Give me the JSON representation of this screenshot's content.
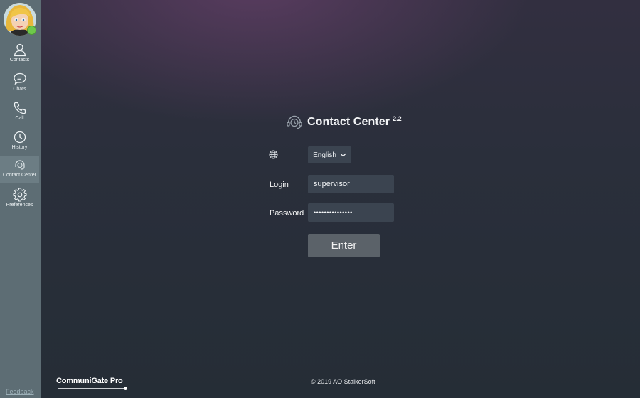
{
  "sidebar": {
    "items": [
      {
        "label": "Contacts",
        "icon": "person-icon"
      },
      {
        "label": "Chats",
        "icon": "chat-bubble-icon"
      },
      {
        "label": "Call",
        "icon": "phone-icon"
      },
      {
        "label": "History",
        "icon": "clock-icon"
      },
      {
        "label": "Contact Center",
        "icon": "headset-icon",
        "active": true
      },
      {
        "label": "Preferences",
        "icon": "gear-icon"
      }
    ],
    "feedback_label": "Feedback",
    "presence_status_color": "#6ec84b"
  },
  "login_form": {
    "title": "Contact Center",
    "version": "2.2",
    "language": "English",
    "login_label": "Login",
    "login_value": "supervisor",
    "password_label": "Password",
    "password_value": "•••••••••••••••",
    "enter_label": "Enter"
  },
  "footer": {
    "brand": "CommuniGate Pro",
    "copyright": "© 2019 AO StalkerSoft"
  },
  "colors": {
    "sidebar_bg": "#5d6d74",
    "main_bg": "#263039",
    "input_bg": "#3b4450",
    "button_bg": "#5b6269"
  }
}
